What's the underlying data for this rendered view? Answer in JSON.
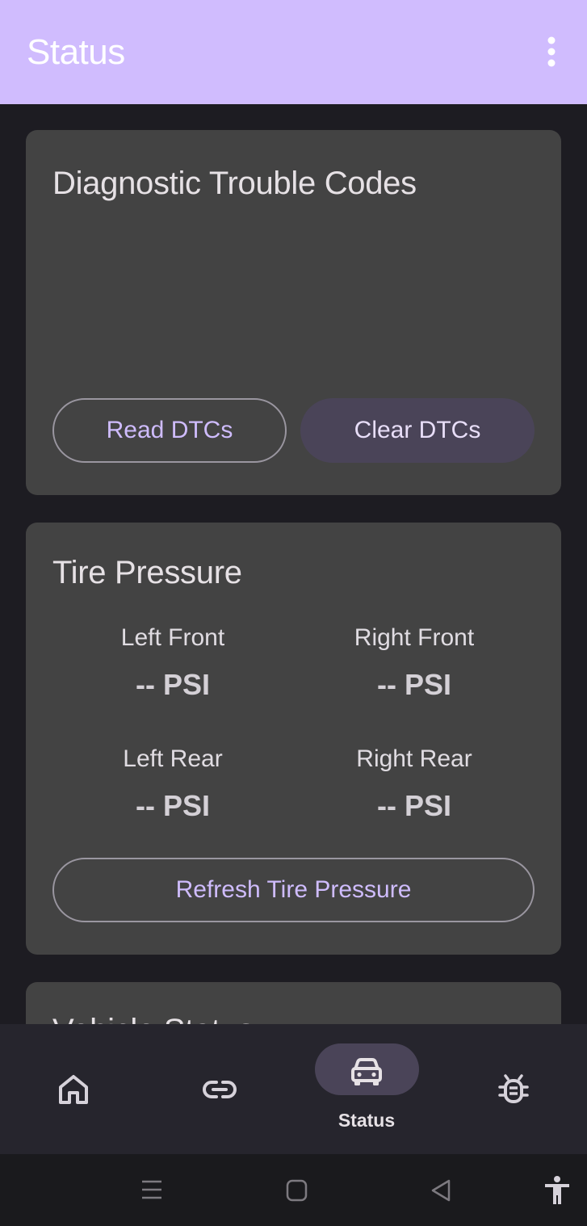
{
  "app_bar": {
    "title": "Status",
    "menu_icon": "more-vert-icon",
    "background": "#d0bcfe"
  },
  "dtc_card": {
    "title": "Diagnostic Trouble Codes",
    "read_button": "Read DTCs",
    "clear_button": "Clear DTCs"
  },
  "tire_card": {
    "title": "Tire Pressure",
    "tires": [
      {
        "label": "Left Front",
        "value": "-- PSI"
      },
      {
        "label": "Right Front",
        "value": "-- PSI"
      },
      {
        "label": "Left Rear",
        "value": "-- PSI"
      },
      {
        "label": "Right Rear",
        "value": "-- PSI"
      }
    ],
    "refresh_button": "Refresh Tire Pressure"
  },
  "vehicle_card": {
    "title": "Vehicle Status"
  },
  "bottom_nav": {
    "items": [
      {
        "icon": "home-icon",
        "label": ""
      },
      {
        "icon": "link-icon",
        "label": ""
      },
      {
        "icon": "car-icon",
        "label": "Status",
        "selected": true
      },
      {
        "icon": "bug-icon",
        "label": ""
      }
    ]
  },
  "system_nav": {
    "icons": [
      "recents-icon",
      "home-square-icon",
      "back-icon",
      "accessibility-icon"
    ]
  },
  "colors": {
    "background": "#1d1c22",
    "card": "#434343",
    "accent": "#cfbcfd",
    "indicator": "#4a4458"
  }
}
